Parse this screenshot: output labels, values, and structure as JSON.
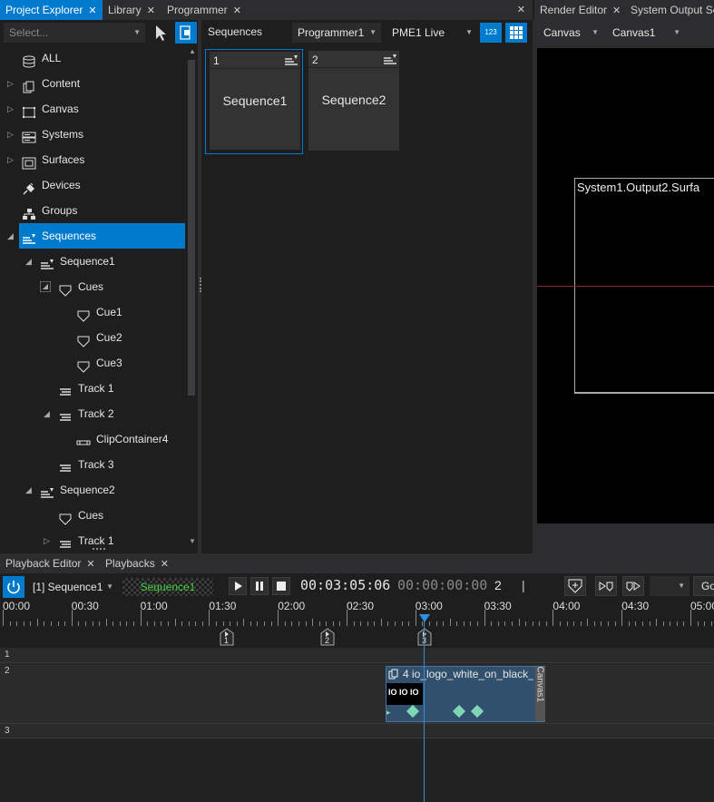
{
  "top_tabs_left": [
    {
      "label": "Project Explorer",
      "close": "✕",
      "active": true
    },
    {
      "label": "Library",
      "close": "✕",
      "active": false
    },
    {
      "label": "Programmer",
      "close": "✕",
      "active": false
    }
  ],
  "top_tabs_right": [
    {
      "label": "Render Editor",
      "close": "✕"
    },
    {
      "label": "System Output Se",
      "close": ""
    }
  ],
  "panel_close": "✕",
  "explorer": {
    "filter_placeholder": "Select...",
    "items": [
      {
        "label": "ALL"
      },
      {
        "label": "Content"
      },
      {
        "label": "Canvas"
      },
      {
        "label": "Systems"
      },
      {
        "label": "Surfaces"
      },
      {
        "label": "Devices"
      },
      {
        "label": "Groups"
      },
      {
        "label": "Sequences"
      },
      {
        "label": "Sequence1"
      },
      {
        "label": "Cues"
      },
      {
        "label": "Cue1"
      },
      {
        "label": "Cue2"
      },
      {
        "label": "Cue3"
      },
      {
        "label": "Track 1"
      },
      {
        "label": "Track 2"
      },
      {
        "label": "ClipContainer4"
      },
      {
        "label": "Track 3"
      },
      {
        "label": "Sequence2"
      },
      {
        "label": "Cues"
      },
      {
        "label": "Track 1"
      }
    ]
  },
  "sequences_panel": {
    "title": "Sequences",
    "programmer": "Programmer1",
    "live": "PME1 Live",
    "num_toggle": "123",
    "cards": [
      {
        "number": "1",
        "name": "Sequence1"
      },
      {
        "number": "2",
        "name": "Sequence2"
      }
    ]
  },
  "render_editor": {
    "mode": "Canvas",
    "canvas": "Canvas1",
    "surface_label": "System1.Output2.Surfa"
  },
  "bottom_tabs": [
    {
      "label": "Playback Editor",
      "close": "✕"
    },
    {
      "label": "Playbacks",
      "close": "✕"
    }
  ],
  "playback": {
    "sequence_select": "[1] Sequence1",
    "sequence_name": "Sequence1",
    "timecode_current": "00:03:05:06",
    "timecode_secondary": "00:00:00:00",
    "cue_number": "2",
    "cursor_mark": "|",
    "goto_label": "Go",
    "ruler_labels": [
      "00:00",
      "00:30",
      "01:00",
      "01:30",
      "02:00",
      "02:30",
      "03:00",
      "03:30",
      "04:00",
      "04:30",
      "05:00"
    ],
    "cue_markers": [
      "1",
      "2",
      "3"
    ],
    "track_labels": [
      "1",
      "2",
      "3"
    ],
    "clip": {
      "index": "4",
      "name": "io_logo_white_on_black_H",
      "canvas": "Canvas1",
      "thumb_text": "IO IO IO"
    }
  },
  "colors": {
    "accent": "#007acc",
    "bg": "#1e1e1e",
    "sequence_green": "#3fcf3f",
    "keyframe": "#7ed6b4",
    "clip_bg": "#30506e"
  }
}
